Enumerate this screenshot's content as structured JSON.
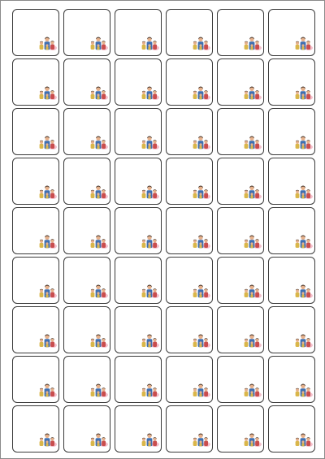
{
  "sheet": {
    "rows": 9,
    "columns": 6,
    "label_icon": "family-photo-icon"
  },
  "colors": {
    "page_background": "#ffffff",
    "sheet_border": "#8a8a8a",
    "label_border": "#3a3a3a",
    "photo_skin": "#e6b18c",
    "photo_hair": "#3b2a20",
    "photo_shirt_blue": "#3f6fb1",
    "photo_shirt_yellow": "#d9b64a",
    "photo_shirt_red": "#c94d4d",
    "photo_accent": "#e98aa0"
  }
}
